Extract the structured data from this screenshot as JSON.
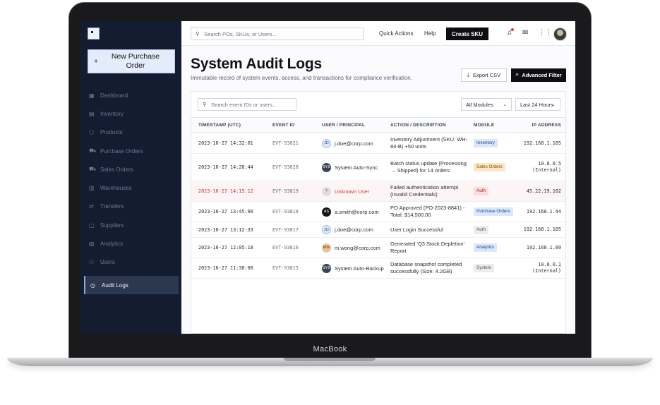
{
  "device": {
    "brand": "MacBook"
  },
  "sidebar": {
    "new_po_label": "New Purchase Order",
    "items": [
      {
        "label": "Dashboard",
        "icon": "dashboard-icon",
        "glyph": "▦"
      },
      {
        "label": "Inventory",
        "icon": "inventory-icon",
        "glyph": "▤"
      },
      {
        "label": "Products",
        "icon": "products-icon",
        "glyph": "⬡"
      },
      {
        "label": "Purchase Orders",
        "icon": "cart-icon",
        "glyph": "⛟"
      },
      {
        "label": "Sales Orders",
        "icon": "truck-icon",
        "glyph": "⛟"
      },
      {
        "label": "Warehouses",
        "icon": "warehouse-icon",
        "glyph": "▥"
      },
      {
        "label": "Transfers",
        "icon": "transfer-icon",
        "glyph": "⇄"
      },
      {
        "label": "Suppliers",
        "icon": "suppliers-icon",
        "glyph": "▢"
      },
      {
        "label": "Analytics",
        "icon": "analytics-icon",
        "glyph": "▧"
      },
      {
        "label": "Users",
        "icon": "users-icon",
        "glyph": "⚇"
      },
      {
        "label": "Audit Logs",
        "icon": "history-icon",
        "glyph": "◷",
        "active": true
      }
    ]
  },
  "topbar": {
    "search_placeholder": "Search POs, SKUs, or Users...",
    "quick_actions": "Quick Actions",
    "help": "Help",
    "create_sku": "Create SKU"
  },
  "page": {
    "title": "System Audit Logs",
    "subtitle": "Immutable record of system events, access, and transactions for compliance verification.",
    "export_label": "Export CSV",
    "advanced_filter_label": "Advanced Filter"
  },
  "filters": {
    "search_placeholder": "Search event IDs or users...",
    "module": "All Modules",
    "range": "Last 24 Hours"
  },
  "table": {
    "columns": [
      "TIMESTAMP (UTC)",
      "EVENT ID",
      "USER / PRINCIPAL",
      "ACTION / DESCRIPTION",
      "MODULE",
      "IP ADDRESS"
    ],
    "rows": [
      {
        "timestamp": "2023-10-27 14:32:01",
        "event_id": "EVT-93821",
        "initials": "JD",
        "user": "j.doe@corp.com",
        "action": "Inventory Adjustment (SKU: WH-84-B) +50 units",
        "module": "Inventory",
        "ip": "192.168.1.105"
      },
      {
        "timestamp": "2023-10-27 14:28:44",
        "event_id": "EVT-93820",
        "initials": "SYS",
        "user": "System Auto-Sync",
        "action": "Batch status update (Processing → Shipped) for 14 orders",
        "module": "Sales Orders",
        "ip": "10.0.0.5",
        "ip_note": "(Internal)"
      },
      {
        "timestamp": "2023-10-27 14:15:12",
        "event_id": "EVT-93819",
        "initials": "?",
        "user": "Unknown User",
        "action": "Failed authentication attempt (Invalid Credentials)",
        "module": "Auth",
        "ip": "45.22.19.102",
        "alert": true
      },
      {
        "timestamp": "2023-10-27 13:45:00",
        "event_id": "EVT-93818",
        "initials": "AS",
        "user": "a.smith@corp.com",
        "action": "PO Approved (PO-2023-8841) - Total: $14,500.00",
        "module": "Purchase Orders",
        "ip": "192.168.1.44"
      },
      {
        "timestamp": "2023-10-27 13:12:33",
        "event_id": "EVT-93817",
        "initials": "JD",
        "user": "j.doe@corp.com",
        "action": "User Login Successful",
        "module": "Auth",
        "ip": "192.168.1.105"
      },
      {
        "timestamp": "2023-10-27 12:05:18",
        "event_id": "EVT-93816",
        "initials": "MW",
        "user": "m.wong@corp.com",
        "action": "Generated 'Q3 Stock Depletion' Report",
        "module": "Analytics",
        "ip": "192.168.1.89"
      },
      {
        "timestamp": "2023-10-27 11:30:00",
        "event_id": "EVT-93815",
        "initials": "SYS",
        "user": "System Auto-Backup",
        "action": "Database snapshot completed successfully (Size: 4.2GB)",
        "module": "System",
        "ip": "10.0.0.1",
        "ip_note": "(Internal)"
      }
    ]
  }
}
